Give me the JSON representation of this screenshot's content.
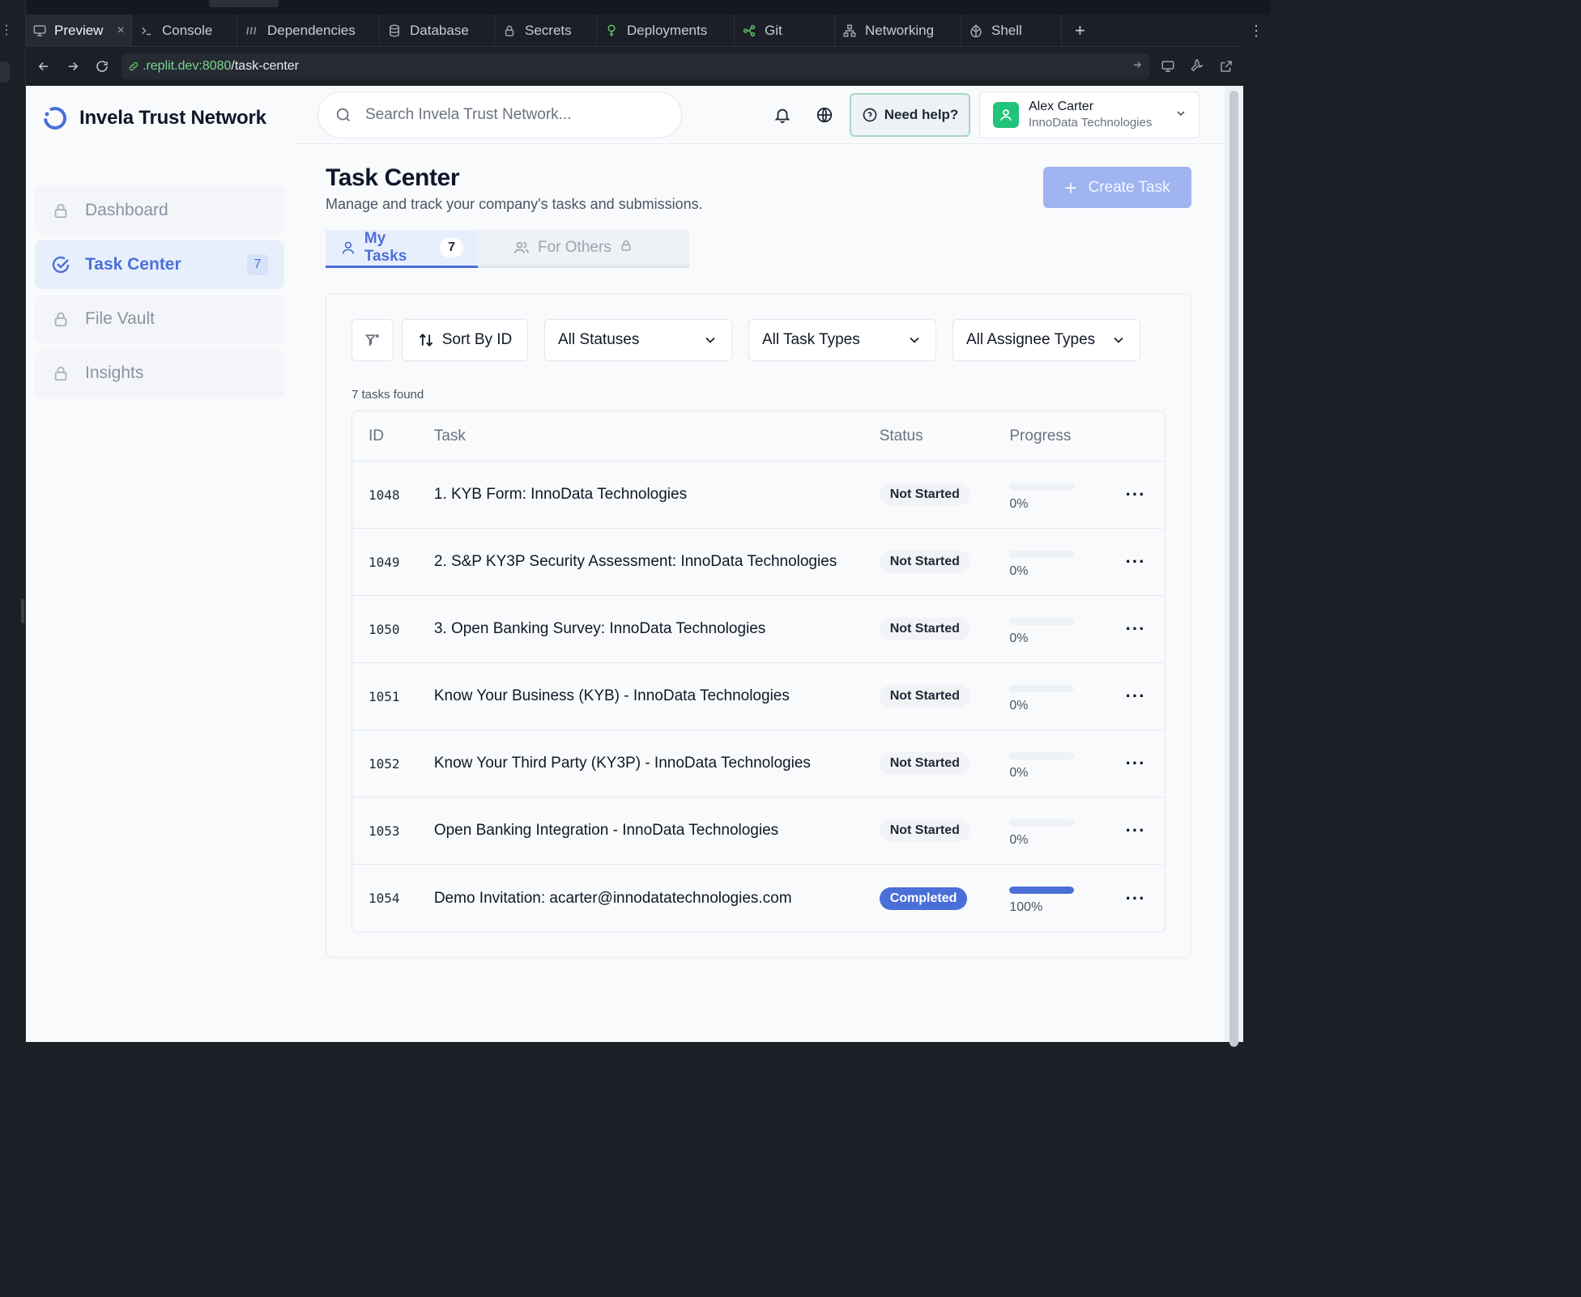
{
  "ide": {
    "tabs": [
      {
        "label": "Preview",
        "icon": "monitor-icon",
        "active": true
      },
      {
        "label": "Console",
        "icon": "terminal-icon"
      },
      {
        "label": "Dependencies",
        "icon": "dependencies-icon"
      },
      {
        "label": "Database",
        "icon": "database-icon"
      },
      {
        "label": "Secrets",
        "icon": "lock-icon"
      },
      {
        "label": "Deployments",
        "icon": "deployments-icon"
      },
      {
        "label": "Git",
        "icon": "git-icon"
      },
      {
        "label": "Networking",
        "icon": "network-icon"
      },
      {
        "label": "Shell",
        "icon": "shell-icon"
      }
    ],
    "close_glyph": "×",
    "add_glyph": "+",
    "url": {
      "host": ".replit.dev:8080",
      "path": "/task-center"
    }
  },
  "app": {
    "brand": "Invela Trust Network",
    "search_placeholder": "Search Invela Trust Network...",
    "help_label": "Need help?",
    "user": {
      "name": "Alex Carter",
      "company": "InnoData Technologies"
    },
    "nav": [
      {
        "label": "Dashboard",
        "locked": true
      },
      {
        "label": "Task Center",
        "active": true,
        "badge": "7"
      },
      {
        "label": "File Vault",
        "locked": true
      },
      {
        "label": "Insights",
        "locked": true
      }
    ]
  },
  "page": {
    "title": "Task Center",
    "subtitle": "Manage and track your company's tasks and submissions.",
    "create_label": "Create Task",
    "tabs": {
      "my_tasks": {
        "label": "My Tasks",
        "count": "7"
      },
      "for_others": {
        "label": "For Others"
      }
    },
    "filters": {
      "sort_label": "Sort By ID",
      "status": "All Statuses",
      "task_types": "All Task Types",
      "assignee_types": "All Assignee Types"
    },
    "count_text": "7 tasks found",
    "table": {
      "headers": {
        "id": "ID",
        "task": "Task",
        "status": "Status",
        "progress": "Progress"
      },
      "rows": [
        {
          "id": "1048",
          "task": "1. KYB Form: InnoData Technologies",
          "status": "Not Started",
          "progress": 0,
          "progress_text": "0%"
        },
        {
          "id": "1049",
          "task": "2. S&P KY3P Security Assessment: InnoData Technologies",
          "status": "Not Started",
          "progress": 0,
          "progress_text": "0%"
        },
        {
          "id": "1050",
          "task": "3. Open Banking Survey: InnoData Technologies",
          "status": "Not Started",
          "progress": 0,
          "progress_text": "0%"
        },
        {
          "id": "1051",
          "task": "Know Your Business (KYB) - InnoData Technologies",
          "status": "Not Started",
          "progress": 0,
          "progress_text": "0%"
        },
        {
          "id": "1052",
          "task": "Know Your Third Party (KY3P) - InnoData Technologies",
          "status": "Not Started",
          "progress": 0,
          "progress_text": "0%"
        },
        {
          "id": "1053",
          "task": "Open Banking Integration - InnoData Technologies",
          "status": "Not Started",
          "progress": 0,
          "progress_text": "0%"
        },
        {
          "id": "1054",
          "task": "Demo Invitation: acarter@innodatatechnologies.com",
          "status": "Completed",
          "progress": 1,
          "progress_text": "100%"
        }
      ]
    }
  },
  "colors": {
    "accent": "#4b6fd8",
    "accent_soft": "#e8effc",
    "success": "#22c37a",
    "url_host": "#7bd88f"
  }
}
